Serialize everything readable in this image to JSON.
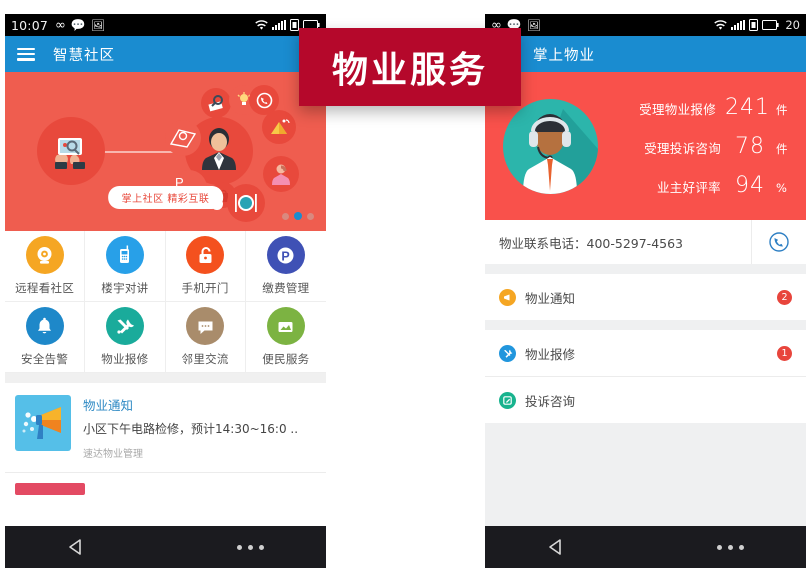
{
  "overlay": {
    "label": "物业服务",
    "bg": "#b5082b"
  },
  "left_phone": {
    "status_bar": {
      "time": "10:07",
      "icons": [
        "infinity-icon",
        "chat-bubble-icon",
        "image-icon"
      ],
      "right_icons": [
        "wifi-icon",
        "signal-icon",
        "sim-icon",
        "battery-icon"
      ]
    },
    "app_bar": {
      "title": "智慧社区",
      "menu": "menu-icon",
      "bg": "#1a8cd0"
    },
    "hero": {
      "pill_text": "掌上社区 精彩互联",
      "bg": "#ef5d4f",
      "dots": 3,
      "active_dot": 2
    },
    "grid": [
      {
        "label": "远程看社区",
        "icon": "camera-icon",
        "color": "#f5a623"
      },
      {
        "label": "楼宇对讲",
        "icon": "intercom-icon",
        "color": "#28a0e8"
      },
      {
        "label": "手机开门",
        "icon": "unlock-icon",
        "color": "#f4511e"
      },
      {
        "label": "缴费管理",
        "icon": "payment-icon",
        "color": "#3f51b5"
      },
      {
        "label": "安全告警",
        "icon": "bell-icon",
        "color": "#1e88c9"
      },
      {
        "label": "物业报修",
        "icon": "tools-icon",
        "color": "#1aab9b"
      },
      {
        "label": "邻里交流",
        "icon": "chat-icon",
        "color": "#a98c6b"
      },
      {
        "label": "便民服务",
        "icon": "service-icon",
        "color": "#7cb342"
      }
    ],
    "notice_card": {
      "title": "物业通知",
      "desc": "小区下午电路检修，预计14:30~16:0 ..",
      "source": "速达物业管理",
      "thumb": "megaphone-icon"
    },
    "nav": {
      "back": "back-triangle-icon",
      "menu": "overflow-dots-icon"
    }
  },
  "right_phone": {
    "status_bar": {
      "time": "",
      "icons": [
        "infinity-icon",
        "chat-bubble-icon",
        "image-icon"
      ],
      "right_icons": [
        "wifi-icon",
        "signal-icon",
        "sim-icon",
        "battery-icon"
      ],
      "battery_pct": "20"
    },
    "app_bar": {
      "title": "掌上物业",
      "bg": "#1a8cd0"
    },
    "stats": {
      "bg": "#f9514b",
      "avatar": "headset-operator-avatar",
      "rows": [
        {
          "label": "受理物业报修",
          "value": "241",
          "unit": "件"
        },
        {
          "label": "受理投诉咨询",
          "value": "78",
          "unit": "件"
        },
        {
          "label": "业主好评率",
          "value": "94",
          "unit": "%"
        }
      ]
    },
    "contact": {
      "text": "物业联系电话：400-5297-4563",
      "button_icon": "phone-call-icon"
    },
    "list": [
      {
        "label": "物业通知",
        "icon": "megaphone-icon",
        "color": "#f5a623",
        "badge": "2"
      },
      {
        "label": "物业报修",
        "icon": "tools-icon",
        "color": "#2196dd",
        "badge": "1"
      },
      {
        "label": "投诉咨询",
        "icon": "edit-icon",
        "color": "#18b38e",
        "badge": ""
      }
    ],
    "nav": {
      "back": "back-triangle-icon",
      "menu": "overflow-dots-icon"
    }
  }
}
